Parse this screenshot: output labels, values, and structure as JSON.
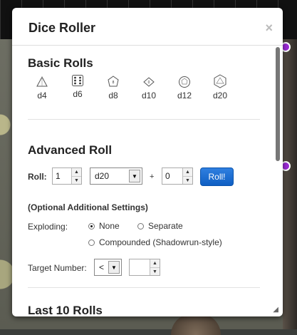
{
  "window": {
    "title": "Dice Roller",
    "close_glyph": "×"
  },
  "basic_rolls": {
    "heading": "Basic Rolls",
    "dice": [
      {
        "label": "d4",
        "icon": "d4-icon"
      },
      {
        "label": "d6",
        "icon": "d6-icon"
      },
      {
        "label": "d8",
        "icon": "d8-icon"
      },
      {
        "label": "d10",
        "icon": "d10-icon"
      },
      {
        "label": "d12",
        "icon": "d12-icon"
      },
      {
        "label": "d20",
        "icon": "d20-icon"
      }
    ]
  },
  "advanced": {
    "heading": "Advanced Roll",
    "roll_label": "Roll:",
    "count_value": "1",
    "die_value": "d20",
    "plus": "+",
    "modifier_value": "0",
    "roll_button": "Roll!",
    "optional_heading": "(Optional Additional Settings)",
    "exploding_label": "Exploding:",
    "options": [
      {
        "label": "None",
        "selected": true
      },
      {
        "label": "Separate",
        "selected": false
      },
      {
        "label": "Compounded (Shadowrun-style)",
        "selected": false
      }
    ],
    "target_label": "Target Number:",
    "target_operator": "<",
    "target_value": ""
  },
  "last_rolls": {
    "heading": "Last 10 Rolls"
  },
  "colors": {
    "accent": "#1a6fd6",
    "handle": "#9b2ad6"
  }
}
